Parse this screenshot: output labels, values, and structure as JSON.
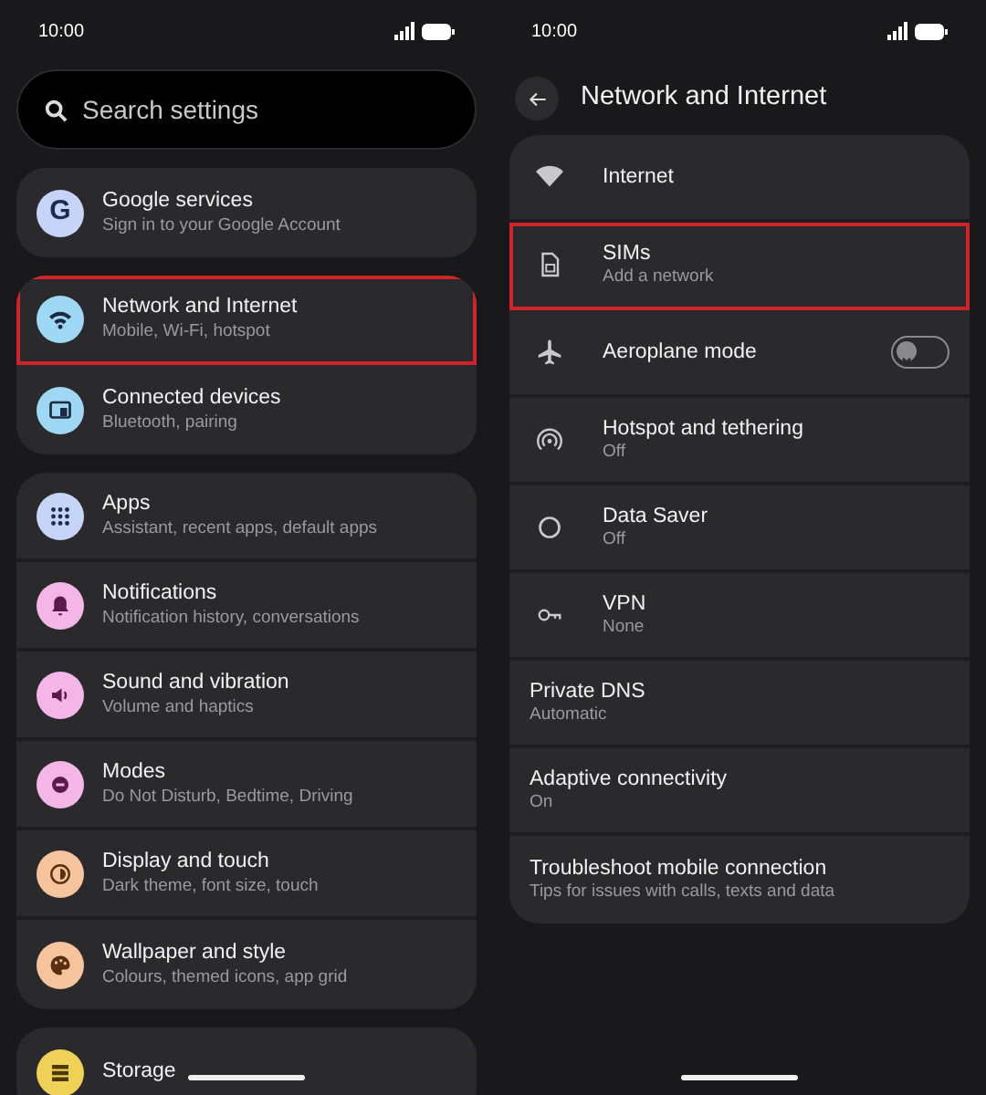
{
  "left_screen": {
    "status_bar": {
      "time": "10:00"
    },
    "search": {
      "placeholder": "Search settings"
    },
    "groups": [
      {
        "items": [
          {
            "title": "Google services",
            "subtitle": "Sign in to your Google Account",
            "color": "#c6d5f7",
            "icon_letter": "G",
            "highlighted": false
          }
        ]
      },
      {
        "items": [
          {
            "title": "Network and Internet",
            "subtitle": "Mobile, Wi-Fi, hotspot",
            "color": "#9fd8f5",
            "highlighted": true
          },
          {
            "title": "Connected devices",
            "subtitle": "Bluetooth, pairing",
            "color": "#9fd8f5",
            "highlighted": false
          }
        ]
      },
      {
        "items": [
          {
            "title": "Apps",
            "subtitle": "Assistant, recent apps, default apps",
            "color": "#c6d5f7",
            "highlighted": false
          },
          {
            "title": "Notifications",
            "subtitle": "Notification history, conversations",
            "color": "#f3b6e6",
            "highlighted": false
          },
          {
            "title": "Sound and vibration",
            "subtitle": "Volume and haptics",
            "color": "#f3b6e6",
            "highlighted": false
          },
          {
            "title": "Modes",
            "subtitle": "Do Not Disturb, Bedtime, Driving",
            "color": "#f3b6e6",
            "highlighted": false
          },
          {
            "title": "Display and touch",
            "subtitle": "Dark theme, font size, touch",
            "color": "#f6c49c",
            "highlighted": false
          },
          {
            "title": "Wallpaper and style",
            "subtitle": "Colours, themed icons, app grid",
            "color": "#f6c49c",
            "highlighted": false
          }
        ]
      },
      {
        "items": [
          {
            "title": "Storage",
            "color": "#f0d158",
            "highlighted": false
          }
        ]
      }
    ]
  },
  "right_screen": {
    "status_bar": {
      "time": "10:00"
    },
    "title": "Network and Internet",
    "items": [
      {
        "kind": "icon",
        "title": "Internet",
        "highlighted": false
      },
      {
        "kind": "icon",
        "title": "SIMs",
        "subtitle": "Add a network",
        "highlighted": true
      },
      {
        "kind": "toggle",
        "title": "Aeroplane mode",
        "on": false,
        "highlighted": false
      },
      {
        "kind": "icon",
        "title": "Hotspot and tethering",
        "subtitle": "Off",
        "highlighted": false
      },
      {
        "kind": "icon",
        "title": "Data Saver",
        "subtitle": "Off",
        "highlighted": false
      },
      {
        "kind": "icon",
        "title": "VPN",
        "subtitle": "None",
        "highlighted": false
      },
      {
        "kind": "text",
        "title": "Private DNS",
        "subtitle": "Automatic",
        "highlighted": false
      },
      {
        "kind": "text",
        "title": "Adaptive connectivity",
        "subtitle": "On",
        "highlighted": false
      },
      {
        "kind": "text",
        "title": "Troubleshoot mobile connection",
        "subtitle": "Tips for issues with calls, texts and data",
        "highlighted": false
      }
    ]
  }
}
